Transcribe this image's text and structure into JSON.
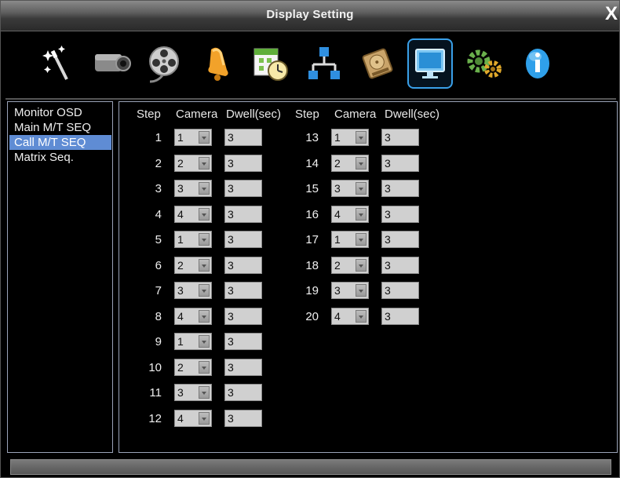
{
  "window": {
    "title": "Display Setting",
    "close_label": "X"
  },
  "toolbar": {
    "items": [
      {
        "name": "wizard-icon"
      },
      {
        "name": "camera-icon"
      },
      {
        "name": "film-reel-icon"
      },
      {
        "name": "alarm-bell-icon"
      },
      {
        "name": "schedule-calendar-icon"
      },
      {
        "name": "network-icon"
      },
      {
        "name": "hard-disk-icon"
      },
      {
        "name": "monitor-display-icon",
        "active": true
      },
      {
        "name": "system-gears-icon"
      },
      {
        "name": "info-icon"
      }
    ]
  },
  "sidebar": {
    "items": [
      {
        "label": "Monitor OSD"
      },
      {
        "label": "Main M/T SEQ"
      },
      {
        "label": "Call M/T SEQ",
        "selected": true
      },
      {
        "label": "Matrix Seq."
      }
    ]
  },
  "table": {
    "headers": {
      "step": "Step",
      "camera": "Camera",
      "dwell": "Dwell(sec)"
    },
    "left": [
      {
        "step": "1",
        "camera": "1",
        "dwell": "3"
      },
      {
        "step": "2",
        "camera": "2",
        "dwell": "3"
      },
      {
        "step": "3",
        "camera": "3",
        "dwell": "3"
      },
      {
        "step": "4",
        "camera": "4",
        "dwell": "3"
      },
      {
        "step": "5",
        "camera": "1",
        "dwell": "3"
      },
      {
        "step": "6",
        "camera": "2",
        "dwell": "3"
      },
      {
        "step": "7",
        "camera": "3",
        "dwell": "3"
      },
      {
        "step": "8",
        "camera": "4",
        "dwell": "3"
      },
      {
        "step": "9",
        "camera": "1",
        "dwell": "3"
      },
      {
        "step": "10",
        "camera": "2",
        "dwell": "3"
      },
      {
        "step": "11",
        "camera": "3",
        "dwell": "3"
      },
      {
        "step": "12",
        "camera": "4",
        "dwell": "3"
      }
    ],
    "right": [
      {
        "step": "13",
        "camera": "1",
        "dwell": "3"
      },
      {
        "step": "14",
        "camera": "2",
        "dwell": "3"
      },
      {
        "step": "15",
        "camera": "3",
        "dwell": "3"
      },
      {
        "step": "16",
        "camera": "4",
        "dwell": "3"
      },
      {
        "step": "17",
        "camera": "1",
        "dwell": "3"
      },
      {
        "step": "18",
        "camera": "2",
        "dwell": "3"
      },
      {
        "step": "19",
        "camera": "3",
        "dwell": "3"
      },
      {
        "step": "20",
        "camera": "4",
        "dwell": "3"
      }
    ]
  },
  "colors": {
    "selection": "#5f8cd4",
    "active_border": "#3aa0e8",
    "field_bg": "#d0d0d0"
  }
}
